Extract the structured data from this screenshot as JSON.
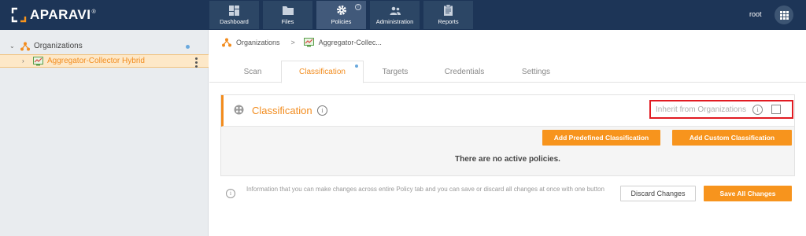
{
  "app": {
    "logo_text": "APARAVI",
    "logo_reg": "®"
  },
  "nav": {
    "items": [
      {
        "label": "Dashboard",
        "icon": "dashboard-icon"
      },
      {
        "label": "Files",
        "icon": "folder-icon"
      },
      {
        "label": "Policies",
        "icon": "gear-icon",
        "active": true
      },
      {
        "label": "Administration",
        "icon": "users-icon"
      },
      {
        "label": "Reports",
        "icon": "clipboard-icon"
      }
    ],
    "policies_badge": "!"
  },
  "header": {
    "user": "root",
    "apps_icon": "grid-icon"
  },
  "sidebar": {
    "root": {
      "label": "Organizations",
      "icon": "organization-icon"
    },
    "child": {
      "label": "Aggregator-Collector Hybrid",
      "icon": "aggregator-icon"
    }
  },
  "breadcrumb": {
    "items": [
      "Organizations",
      "Aggregator-Collec..."
    ],
    "separator": ">"
  },
  "tabs": [
    "Scan",
    "Classification",
    "Targets",
    "Credentials",
    "Settings"
  ],
  "classification": {
    "title": "Classification",
    "info": "i",
    "inherit_label": "Inherit from Organizations",
    "inherit_checked": false,
    "add_predefined": "Add Predefined Classification",
    "add_custom": "Add Custom Classification",
    "empty_message": "There are no active policies."
  },
  "footer": {
    "info": "i",
    "text": "Information that you can make changes across entire Policy tab and you can save or discard all changes at once with one button",
    "discard": "Discard Changes",
    "save": "Save All Changes"
  },
  "colors": {
    "topbar": "#1d3557",
    "accent": "#f7941d",
    "highlight_border": "#e11b22"
  }
}
